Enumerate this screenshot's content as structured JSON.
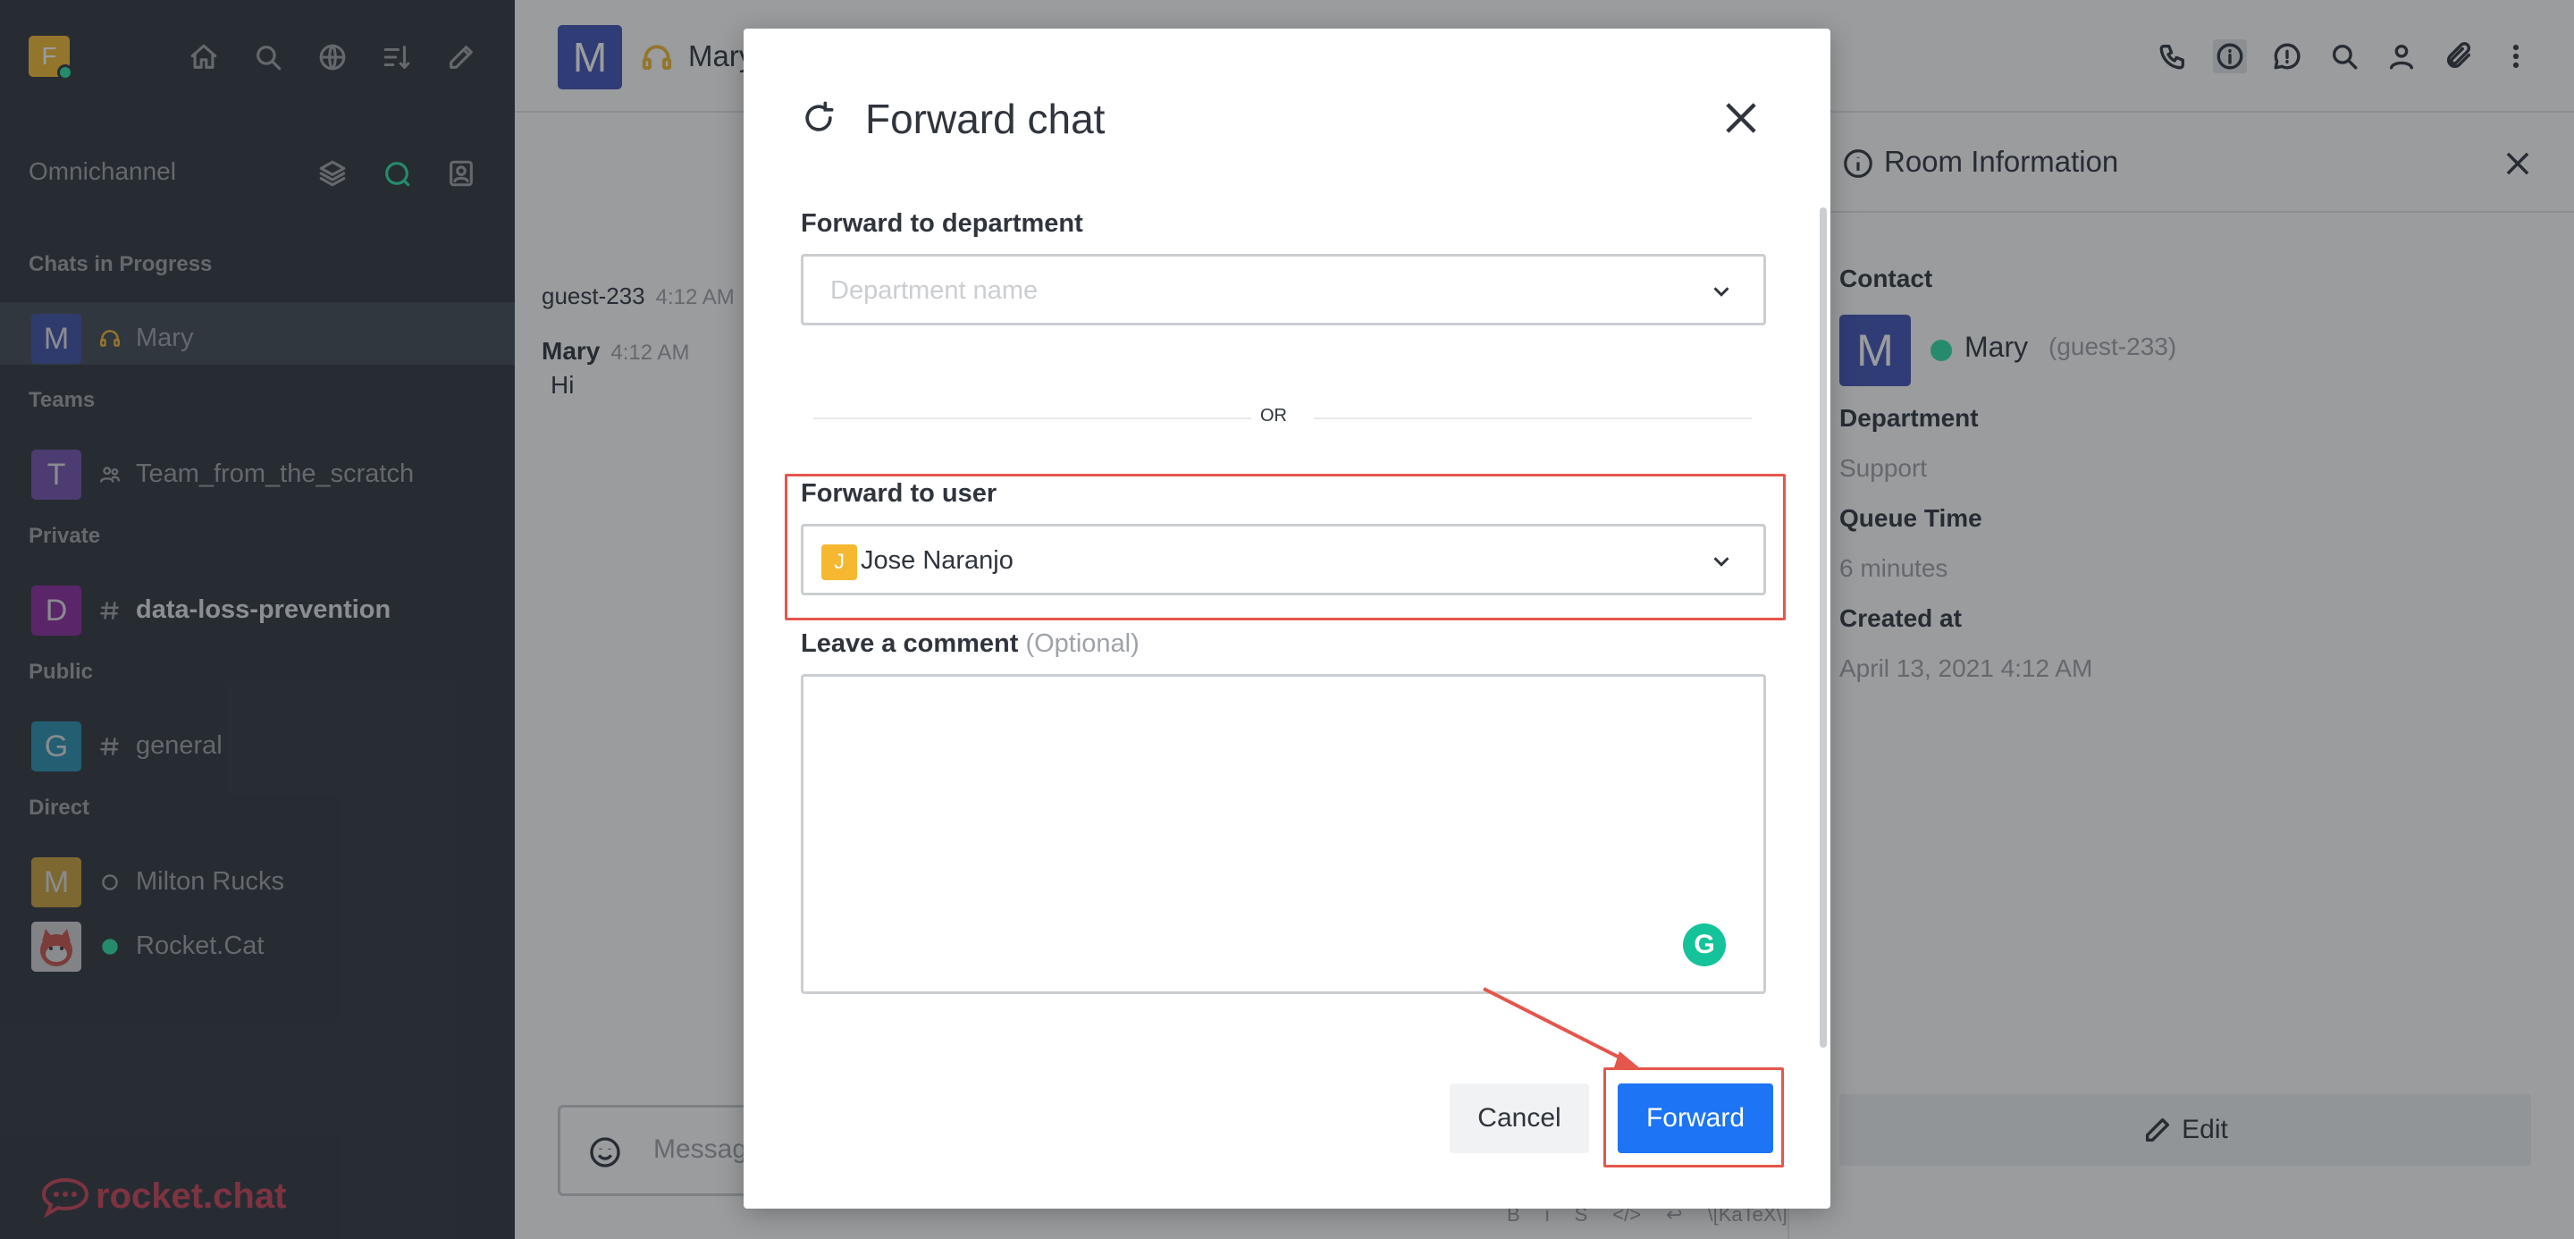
{
  "workspace": {
    "avatar_letter": "F"
  },
  "sidebar": {
    "omnichannel_title": "Omnichannel",
    "sections": {
      "chats_in_progress": "Chats in Progress",
      "teams": "Teams",
      "private": "Private",
      "public": "Public",
      "direct": "Direct"
    },
    "rooms": {
      "mary": {
        "letter": "M",
        "name": "Mary"
      },
      "team": {
        "letter": "T",
        "name": "Team_from_the_scratch"
      },
      "dlp": {
        "letter": "D",
        "name": "data-loss-prevention"
      },
      "general": {
        "letter": "G",
        "name": "general"
      },
      "milton": {
        "letter": "M",
        "name": "Milton Rucks"
      },
      "rocketcat": {
        "name": "Rocket.Cat"
      }
    },
    "logo_text": "rocket.chat"
  },
  "header": {
    "avatar_letter": "M",
    "room_name": "Mary"
  },
  "messages": [
    {
      "author": "guest-233",
      "time": "4:12 AM"
    },
    {
      "author": "Mary",
      "time": "4:12 AM",
      "text": "Hi"
    }
  ],
  "composer": {
    "placeholder": "Messag",
    "format_katex": "\\[KaTeX\\]"
  },
  "room_info": {
    "title": "Room Information",
    "contact_label": "Contact",
    "contact_letter": "M",
    "contact_name": "Mary",
    "contact_username": "(guest-233)",
    "department_label": "Department",
    "department_value": "Support",
    "queue_label": "Queue Time",
    "queue_value": "6 minutes",
    "created_label": "Created at",
    "created_value": "April 13, 2021 4:12 AM",
    "edit_label": "Edit"
  },
  "modal": {
    "title": "Forward chat",
    "department_label": "Forward to department",
    "department_placeholder": "Department name",
    "or_text": "OR",
    "user_label": "Forward to user",
    "user_letter": "J",
    "user_value": "Jose Naranjo",
    "comment_label": "Leave a comment",
    "comment_optional": "(Optional)",
    "cancel_label": "Cancel",
    "forward_label": "Forward"
  },
  "colors": {
    "sidebar_bg": "#2f343d",
    "primary": "#1d74f5",
    "highlight": "#e5564b",
    "online": "#2de0a5"
  }
}
